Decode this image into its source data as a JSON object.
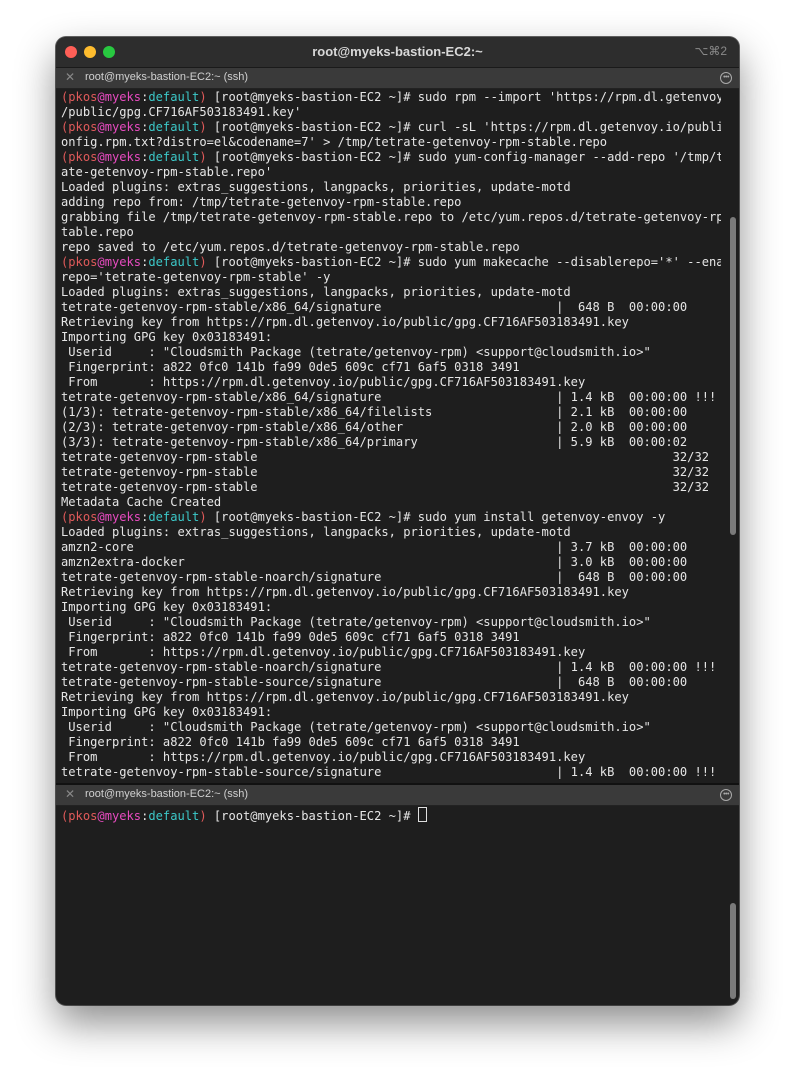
{
  "window": {
    "title": "root@myeks-bastion-EC2:~",
    "shortcut": "⌥⌘2"
  },
  "panes": {
    "top": {
      "title": "root@myeks-bastion-EC2:~ (ssh)",
      "close_glyph": "✕",
      "more_glyph": "•••"
    },
    "bottom": {
      "title": "root@myeks-bastion-EC2:~ (ssh)",
      "close_glyph": "✕",
      "more_glyph": "•••"
    }
  },
  "prompt": {
    "open": "(",
    "user": "pkos",
    "at": "@",
    "host": "myeks",
    "colon": ":",
    "namespace": "default",
    "close": ")",
    "rest": " [root@myeks-bastion-EC2 ~]# "
  },
  "colors": {
    "prompt_red": "#e05a5a",
    "prompt_magenta": "#e64bbf",
    "prompt_cyan": "#3cc9c9"
  },
  "top_lines": [
    {
      "prompt": true,
      "text": "sudo rpm --import 'https://rpm.dl.getenvoy.io"
    },
    {
      "text": "/public/gpg.CF716AF503183491.key'"
    },
    {
      "prompt": true,
      "text": "curl -sL 'https://rpm.dl.getenvoy.io/public/c"
    },
    {
      "text": "onfig.rpm.txt?distro=el&codename=7' > /tmp/tetrate-getenvoy-rpm-stable.repo"
    },
    {
      "prompt": true,
      "text": "sudo yum-config-manager --add-repo '/tmp/tetr"
    },
    {
      "text": "ate-getenvoy-rpm-stable.repo'"
    },
    {
      "text": "Loaded plugins: extras_suggestions, langpacks, priorities, update-motd"
    },
    {
      "text": "adding repo from: /tmp/tetrate-getenvoy-rpm-stable.repo"
    },
    {
      "text": "grabbing file /tmp/tetrate-getenvoy-rpm-stable.repo to /etc/yum.repos.d/tetrate-getenvoy-rpm-s"
    },
    {
      "text": "table.repo"
    },
    {
      "text": "repo saved to /etc/yum.repos.d/tetrate-getenvoy-rpm-stable.repo"
    },
    {
      "prompt": true,
      "text": "sudo yum makecache --disablerepo='*' --enable"
    },
    {
      "text": "repo='tetrate-getenvoy-rpm-stable' -y"
    },
    {
      "text": "Loaded plugins: extras_suggestions, langpacks, priorities, update-motd"
    },
    {
      "text": "tetrate-getenvoy-rpm-stable/x86_64/signature                        |  648 B  00:00:00"
    },
    {
      "text": "Retrieving key from https://rpm.dl.getenvoy.io/public/gpg.CF716AF503183491.key"
    },
    {
      "text": "Importing GPG key 0x03183491:"
    },
    {
      "text": " Userid     : \"Cloudsmith Package (tetrate/getenvoy-rpm) <support@cloudsmith.io>\""
    },
    {
      "text": " Fingerprint: a822 0fc0 141b fa99 0de5 609c cf71 6af5 0318 3491"
    },
    {
      "text": " From       : https://rpm.dl.getenvoy.io/public/gpg.CF716AF503183491.key"
    },
    {
      "text": "tetrate-getenvoy-rpm-stable/x86_64/signature                        | 1.4 kB  00:00:00 !!!"
    },
    {
      "text": "(1/3): tetrate-getenvoy-rpm-stable/x86_64/filelists                 | 2.1 kB  00:00:00"
    },
    {
      "text": "(2/3): tetrate-getenvoy-rpm-stable/x86_64/other                     | 2.0 kB  00:00:00"
    },
    {
      "text": "(3/3): tetrate-getenvoy-rpm-stable/x86_64/primary                   | 5.9 kB  00:00:02"
    },
    {
      "text": "tetrate-getenvoy-rpm-stable                                                         32/32"
    },
    {
      "text": "tetrate-getenvoy-rpm-stable                                                         32/32"
    },
    {
      "text": "tetrate-getenvoy-rpm-stable                                                         32/32"
    },
    {
      "text": "Metadata Cache Created"
    },
    {
      "prompt": true,
      "text": "sudo yum install getenvoy-envoy -y"
    },
    {
      "text": "Loaded plugins: extras_suggestions, langpacks, priorities, update-motd"
    },
    {
      "text": "amzn2-core                                                          | 3.7 kB  00:00:00"
    },
    {
      "text": "amzn2extra-docker                                                   | 3.0 kB  00:00:00"
    },
    {
      "text": "tetrate-getenvoy-rpm-stable-noarch/signature                        |  648 B  00:00:00"
    },
    {
      "text": "Retrieving key from https://rpm.dl.getenvoy.io/public/gpg.CF716AF503183491.key"
    },
    {
      "text": "Importing GPG key 0x03183491:"
    },
    {
      "text": " Userid     : \"Cloudsmith Package (tetrate/getenvoy-rpm) <support@cloudsmith.io>\""
    },
    {
      "text": " Fingerprint: a822 0fc0 141b fa99 0de5 609c cf71 6af5 0318 3491"
    },
    {
      "text": " From       : https://rpm.dl.getenvoy.io/public/gpg.CF716AF503183491.key"
    },
    {
      "text": "tetrate-getenvoy-rpm-stable-noarch/signature                        | 1.4 kB  00:00:00 !!!"
    },
    {
      "text": "tetrate-getenvoy-rpm-stable-source/signature                        |  648 B  00:00:00"
    },
    {
      "text": "Retrieving key from https://rpm.dl.getenvoy.io/public/gpg.CF716AF503183491.key"
    },
    {
      "text": "Importing GPG key 0x03183491:"
    },
    {
      "text": " Userid     : \"Cloudsmith Package (tetrate/getenvoy-rpm) <support@cloudsmith.io>\""
    },
    {
      "text": " Fingerprint: a822 0fc0 141b fa99 0de5 609c cf71 6af5 0318 3491"
    },
    {
      "text": " From       : https://rpm.dl.getenvoy.io/public/gpg.CF716AF503183491.key"
    },
    {
      "text": "tetrate-getenvoy-rpm-stable-source/signature                        | 1.4 kB  00:00:00 !!!"
    }
  ],
  "bottom_lines": [
    {
      "prompt": true,
      "text": "",
      "cursor": true
    }
  ]
}
